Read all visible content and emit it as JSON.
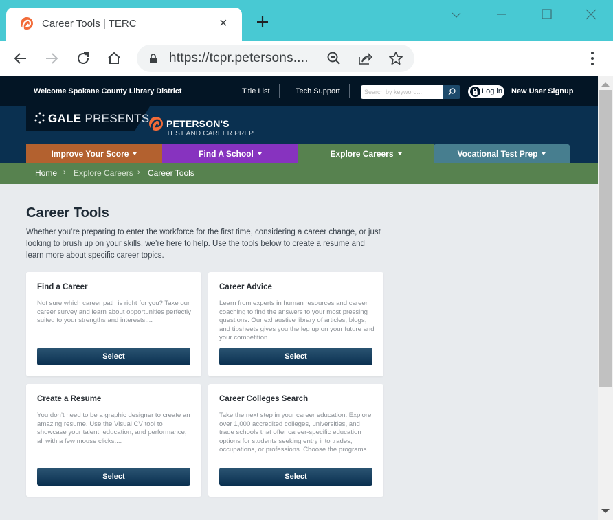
{
  "browser": {
    "tab_title": "Career Tools | TERC",
    "url": "https://tcpr.petersons....",
    "tab_close": "×"
  },
  "topbar": {
    "welcome": "Welcome Spokane County Library District",
    "links": [
      "Title List",
      "Tech Support"
    ],
    "search_placeholder": "Search by keyword...",
    "login": "Log in",
    "signup": "New User Signup"
  },
  "brand": {
    "gale": "GALE",
    "presents": "PRESENTS",
    "petersons": "PETERSON'S",
    "petersons_sub": "TEST AND CAREER PREP"
  },
  "nav": [
    {
      "label": "Improve Your Score",
      "color": "#b3612f"
    },
    {
      "label": "Find A School",
      "color": "#8733bf"
    },
    {
      "label": "Explore Careers",
      "color": "#57824f"
    },
    {
      "label": "Vocational Test Prep",
      "color": "#477e8f"
    }
  ],
  "breadcrumb": [
    "Home",
    "Explore Careers",
    "Career Tools"
  ],
  "breadcrumb_sep": "›",
  "page": {
    "title": "Career Tools",
    "intro": "Whether you’re preparing to enter the workforce for the first time, considering a career change, or just looking to brush up on your skills, we’re here to help. Use the tools below to create a resume and learn more about specific career topics."
  },
  "cards": [
    {
      "title": "Find a Career",
      "desc": "Not sure which career path is right for you? Take our career survey and learn about opportunities perfectly suited to your strengths and interests....",
      "button": "Select"
    },
    {
      "title": "Career Advice",
      "desc": "Learn from experts in human resources and career coaching to find the answers to your most pressing questions. Our exhaustive library of articles, blogs, and tipsheets gives you the leg up on your future and your competition....",
      "button": "Select"
    },
    {
      "title": "Create a Resume",
      "desc": "You don’t need to be a graphic designer to create an amazing resume. Use the Visual CV tool to showcase your talent, education, and performance, all with a few mouse clicks....",
      "button": "Select"
    },
    {
      "title": "Career Colleges Search",
      "desc": "Take the next step in your career education. Explore over 1,000 accredited colleges, universities, and trade schools that offer career-specific education options for students seeking entry into trades, occupations, or professions. Choose the programs...",
      "button": "Select"
    }
  ]
}
